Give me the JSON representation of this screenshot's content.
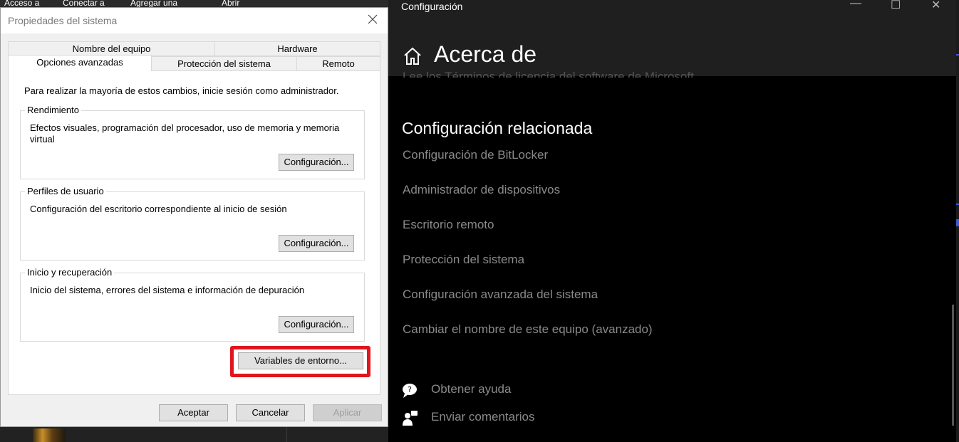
{
  "background_toolbar": {
    "items": [
      "Acceso a",
      "Conectar a",
      "Agregar una",
      "Abrir"
    ]
  },
  "dialog": {
    "title": "Propiedades del sistema",
    "tabs_top": [
      "Nombre del equipo",
      "Hardware"
    ],
    "tabs_bottom": [
      "Opciones avanzadas",
      "Protección del sistema",
      "Remoto"
    ],
    "active_tab": "Opciones avanzadas",
    "intro": "Para realizar la mayoría de estos cambios, inicie sesión como administrador.",
    "groups": [
      {
        "title": "Rendimiento",
        "description": "Efectos visuales, programación del procesador, uso de memoria y memoria virtual",
        "button": "Configuración..."
      },
      {
        "title": "Perfiles de usuario",
        "description": "Configuración del escritorio correspondiente al inicio de sesión",
        "button": "Configuración..."
      },
      {
        "title": "Inicio y recuperación",
        "description": "Inicio del sistema, errores del sistema e información de depuración",
        "button": "Configuración..."
      }
    ],
    "env_button": "Variables de entorno...",
    "footer": {
      "ok": "Aceptar",
      "cancel": "Cancelar",
      "apply": "Aplicar",
      "apply_enabled": false
    },
    "highlight_color": "#e0161e"
  },
  "settings": {
    "window_title": "Configuración",
    "page_title": "Acerca de",
    "partial_text": "Lee los Términos de licencia del software de Microsoft",
    "section_title": "Configuración relacionada",
    "links": [
      "Configuración de BitLocker",
      "Administrador de dispositivos",
      "Escritorio remoto",
      "Protección del sistema",
      "Configuración avanzada del sistema",
      "Cambiar el nombre de este equipo (avanzado)"
    ],
    "help": "Obtener ayuda",
    "feedback": "Enviar comentarios",
    "controls": {
      "minimize": "—",
      "maximize": "☐",
      "close": "✕"
    }
  }
}
